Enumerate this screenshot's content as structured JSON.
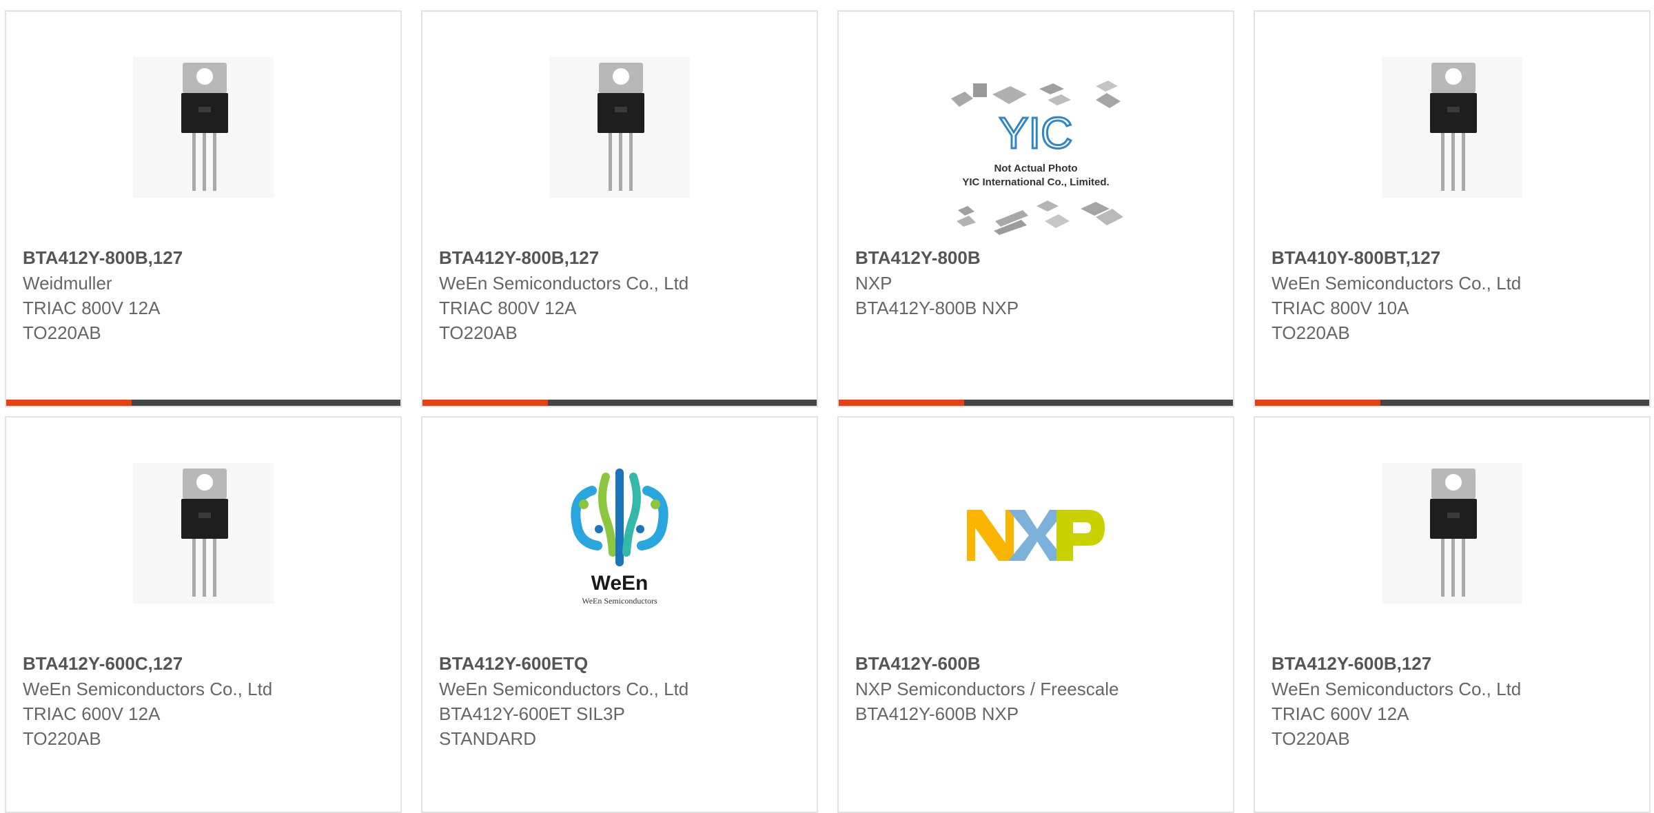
{
  "colors": {
    "accent": "#e8410f",
    "bar_dark": "#454545",
    "card_border": "#e2e2e2",
    "text": "#555555"
  },
  "products": [
    {
      "part_number": "BTA412Y-800B,127",
      "manufacturer": "Weidmuller",
      "description": "TRIAC 800V 12A TO220AB",
      "image": "triac-to220-icon",
      "accent_bar": true
    },
    {
      "part_number": "BTA412Y-800B,127",
      "manufacturer": "WeEn Semiconductors Co., Ltd",
      "description": "TRIAC 800V 12A TO220AB",
      "image": "triac-to220-icon",
      "accent_bar": true
    },
    {
      "part_number": "BTA412Y-800B",
      "manufacturer": "NXP",
      "description": "BTA412Y-800B NXP",
      "image": "yic-placeholder",
      "image_text": {
        "logo": "YIC",
        "line1": "Not Actual Photo",
        "line2": "YIC International Co., Limited."
      },
      "accent_bar": true
    },
    {
      "part_number": "BTA410Y-800BT,127",
      "manufacturer": "WeEn Semiconductors Co., Ltd",
      "description": "TRIAC 800V 10A TO220AB",
      "image": "triac-to220-icon",
      "accent_bar": true
    },
    {
      "part_number": "BTA412Y-600C,127",
      "manufacturer": "WeEn Semiconductors Co., Ltd",
      "description": "TRIAC 600V 12A TO220AB",
      "image": "triac-to220-icon",
      "accent_bar": false
    },
    {
      "part_number": "BTA412Y-600ETQ",
      "manufacturer": "WeEn Semiconductors Co., Ltd",
      "description": "BTA412Y-600ET SIL3P STANDARD",
      "image": "ween-logo",
      "image_text": {
        "brand": "WeEn",
        "tagline": "WeEn Semiconductors"
      },
      "accent_bar": false
    },
    {
      "part_number": "BTA412Y-600B",
      "manufacturer": "NXP Semiconductors / Freescale",
      "description": "BTA412Y-600B NXP",
      "image": "nxp-logo",
      "accent_bar": false
    },
    {
      "part_number": "BTA412Y-600B,127",
      "manufacturer": "WeEn Semiconductors Co., Ltd",
      "description": "TRIAC 600V 12A TO220AB",
      "image": "triac-to220-icon",
      "accent_bar": false
    }
  ]
}
